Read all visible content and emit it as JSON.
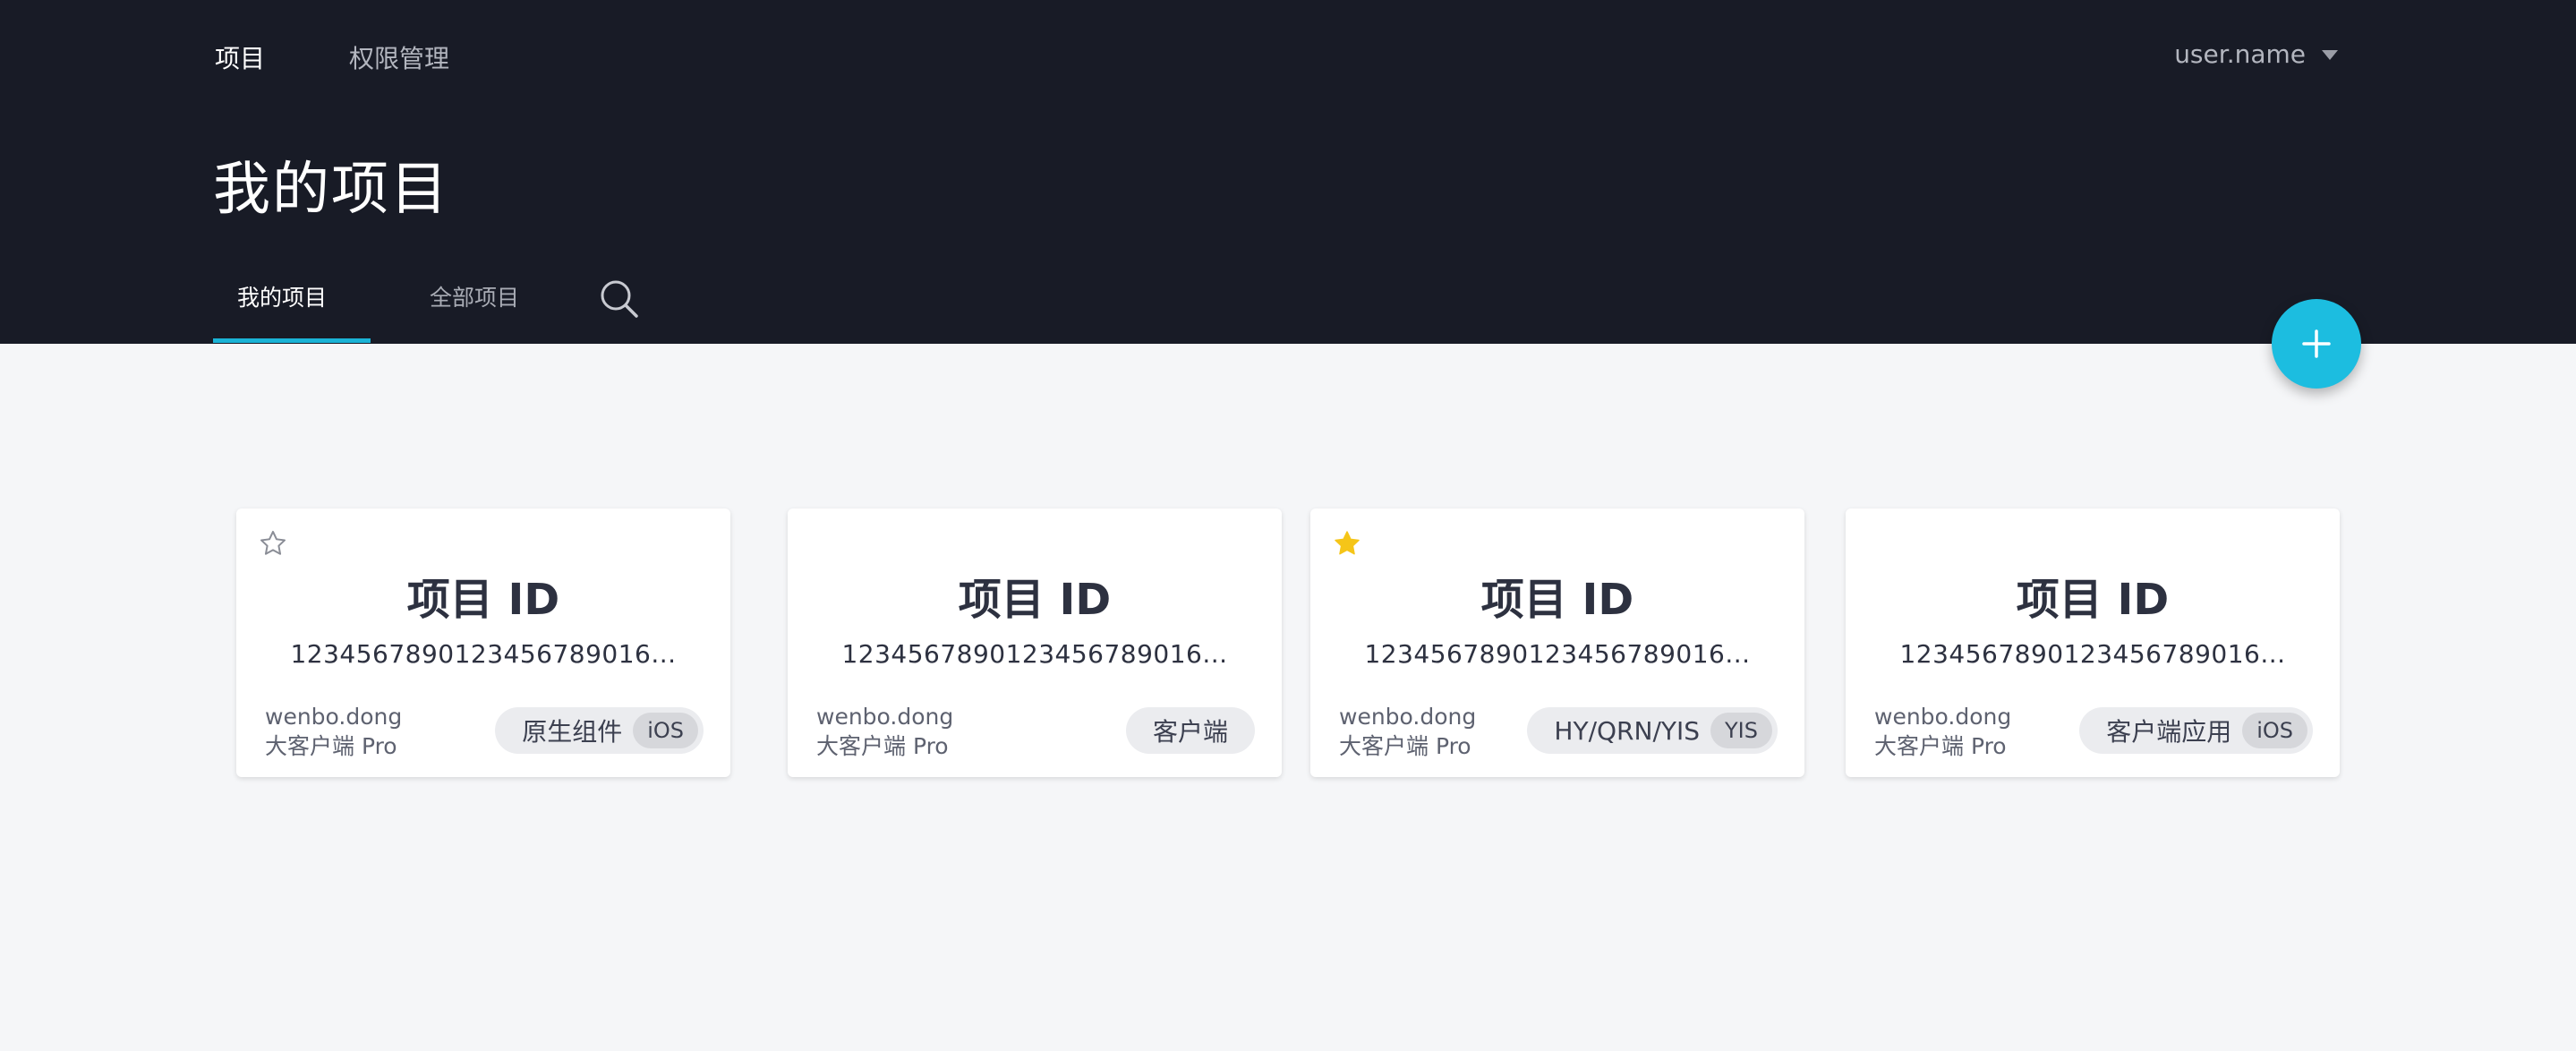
{
  "topnav": {
    "items": [
      {
        "label": "项目",
        "active": true
      },
      {
        "label": "权限管理",
        "active": false
      }
    ],
    "user": "user.name"
  },
  "page_title": "我的项目",
  "tabs": [
    {
      "label": "我的项目",
      "active": true
    },
    {
      "label": "全部项目",
      "active": false
    }
  ],
  "colors": {
    "header_bg": "#181b26",
    "accent": "#1ab3d6",
    "fab": "#1cbde0",
    "star_active": "#f5c518",
    "page_bg": "#f5f6f8"
  },
  "icons": {
    "search": "search-icon",
    "add": "plus-icon",
    "star_empty": "star-outline-icon",
    "star_filled": "star-filled-icon",
    "dropdown": "caret-down-icon"
  },
  "cards": [
    {
      "title": "项目 ID",
      "id": "12345678901234567890​16...",
      "owner": "wenbo.dong",
      "team": "大客户端 Pro",
      "tag": "原生组件",
      "badge": "iOS",
      "starred": false,
      "star_visible": true
    },
    {
      "title": "项目 ID",
      "id": "1234567890123456789016...",
      "owner": "wenbo.dong",
      "team": "大客户端 Pro",
      "tag": "客户端",
      "badge": "",
      "starred": false,
      "star_visible": false
    },
    {
      "title": "项目 ID",
      "id": "1234567890123456789016...",
      "owner": "wenbo.dong",
      "team": "大客户端 Pro",
      "tag": "HY/QRN/YIS",
      "badge": "YIS",
      "starred": true,
      "star_visible": true
    },
    {
      "title": "项目 ID",
      "id": "1234567890123456789016...",
      "owner": "wenbo.dong",
      "team": "大客户端 Pro",
      "tag": "客户端应用",
      "badge": "iOS",
      "starred": false,
      "star_visible": false
    }
  ]
}
